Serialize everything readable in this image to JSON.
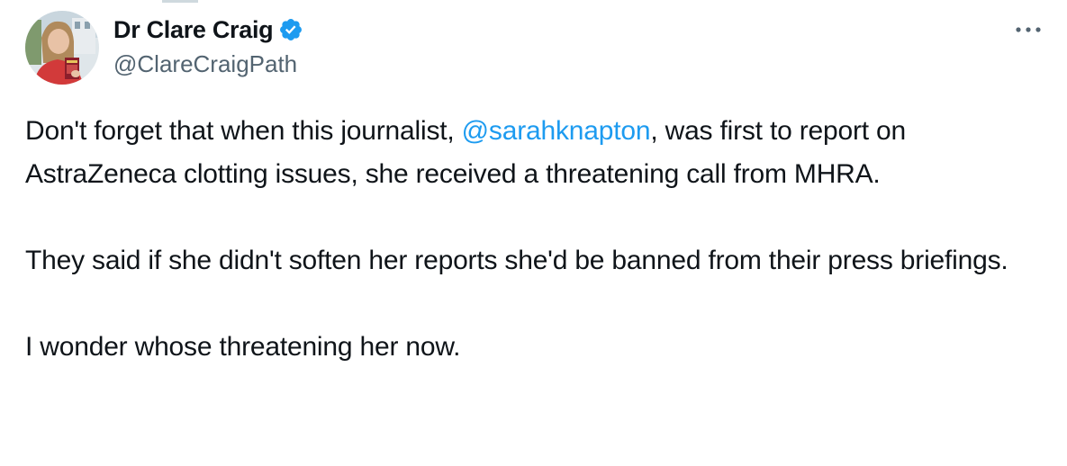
{
  "tweet": {
    "author": {
      "display_name": "Dr Clare Craig",
      "handle": "@ClareCraigPath",
      "verified_icon": "verified-badge-icon",
      "avatar": "profile-photo"
    },
    "more_icon": "more-options-icon",
    "body": {
      "p1_before": "Don't forget that when this journalist, ",
      "p1_mention": "@sarahknapton",
      "p1_after": ", was first to report on AstraZeneca clotting issues, she received a threatening call from MHRA.",
      "p2": "They said if she didn't soften her reports she'd be banned from their press briefings.",
      "p3": "I wonder whose threatening her now."
    }
  },
  "colors": {
    "text": "#0f1419",
    "secondary_text": "#536471",
    "link": "#1d9bf0",
    "verified": "#1d9bf0"
  }
}
